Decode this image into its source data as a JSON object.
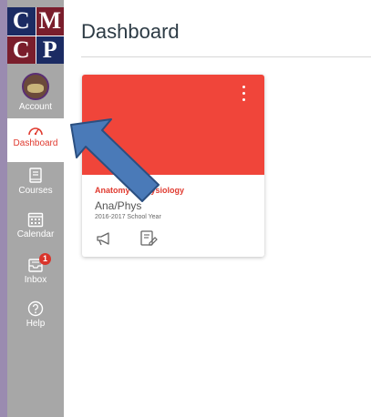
{
  "logo": {
    "letters": [
      "C",
      "M",
      "C",
      "P"
    ]
  },
  "sidebar": {
    "items": [
      {
        "label": "Account",
        "icon": "avatar"
      },
      {
        "label": "Dashboard",
        "icon": "dashboard-icon",
        "active": true
      },
      {
        "label": "Courses",
        "icon": "courses-icon"
      },
      {
        "label": "Calendar",
        "icon": "calendar-icon"
      },
      {
        "label": "Inbox",
        "icon": "inbox-icon",
        "badge": "1"
      },
      {
        "label": "Help",
        "icon": "help-icon"
      }
    ]
  },
  "main": {
    "title": "Dashboard",
    "card": {
      "course_name": "Anatomy & Physiology",
      "course_code": "Ana/Phys",
      "term": "2016-2017 School Year",
      "hero_color": "#f0453a",
      "actions": [
        "announcements-icon",
        "assignments-icon"
      ]
    }
  },
  "annotation": {
    "type": "arrow",
    "color": "#4a7ab8",
    "points_to": "Dashboard"
  },
  "colors": {
    "sidebar_bg": "#a7a7a7",
    "active_text": "#e03a2f",
    "logo_navy": "#1b2b63",
    "logo_maroon": "#7a1e2c"
  }
}
